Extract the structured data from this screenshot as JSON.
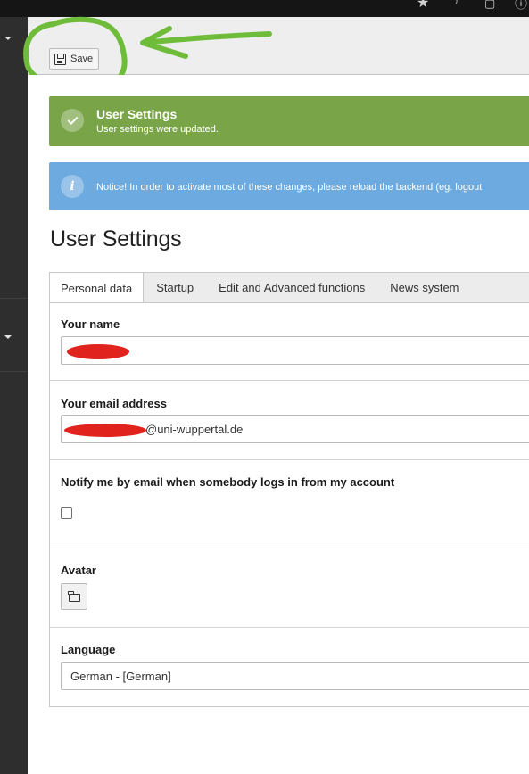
{
  "toolbar": {
    "save_label": "Save"
  },
  "alerts": {
    "success": {
      "title": "User Settings",
      "message": "User settings were updated."
    },
    "info": {
      "message": "Notice! In order to activate most of these changes, please reload the backend (eg. logout"
    }
  },
  "page": {
    "title": "User Settings"
  },
  "tabs": [
    {
      "label": "Personal data"
    },
    {
      "label": "Startup"
    },
    {
      "label": "Edit and Advanced functions"
    },
    {
      "label": "News system"
    }
  ],
  "form": {
    "name": {
      "label": "Your name",
      "value": ""
    },
    "email": {
      "label": "Your email address",
      "value_visible": "@uni-wuppertal.de"
    },
    "notify": {
      "label": "Notify me by email when somebody logs in from my account",
      "checked": false
    },
    "avatar": {
      "label": "Avatar"
    },
    "language": {
      "label": "Language",
      "value": "German - [German]"
    }
  },
  "colors": {
    "success": "#79a548",
    "info": "#6daae0",
    "sidebar": "#2e2e2e",
    "annotation": "#6fbb3a",
    "redaction": "#e0231c"
  },
  "icons": [
    "star-icon",
    "help-icon",
    "window-icon",
    "info-icon",
    "save-icon",
    "check-icon",
    "folder-icon",
    "caret-down-icon",
    "arrow-annotation"
  ]
}
